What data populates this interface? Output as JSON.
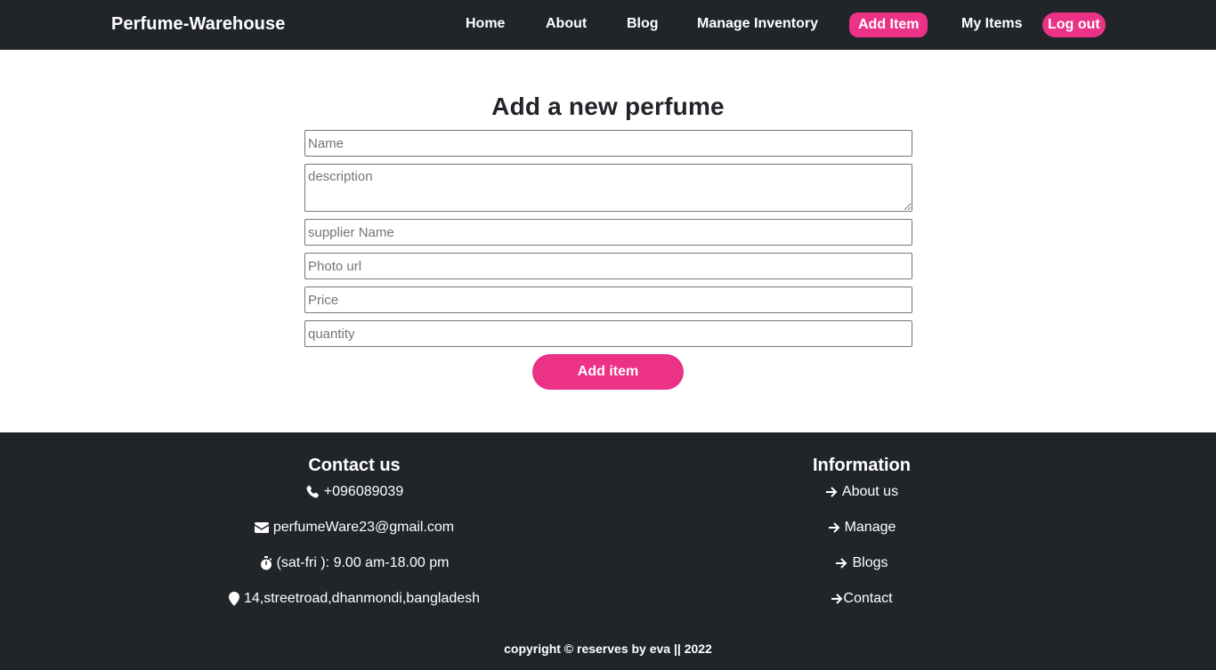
{
  "nav": {
    "brand": "Perfume-Warehouse",
    "home": "Home",
    "about": "About",
    "blog": "Blog",
    "manage_inventory": "Manage Inventory",
    "add_item": "Add Item",
    "my_items": "My Items",
    "logout": "Log out"
  },
  "form": {
    "title": "Add a new perfume",
    "name_placeholder": "Name",
    "description_placeholder": "description",
    "supplier_placeholder": "supplier Name",
    "photo_placeholder": "Photo url",
    "price_placeholder": "Price",
    "quantity_placeholder": "quantity",
    "submit_label": "Add item"
  },
  "footer": {
    "contact": {
      "title": "Contact us",
      "phone": "+096089039",
      "email": "perfumeWare23@gmail.com",
      "hours": "(sat-fri ): 9.00 am-18.00 pm",
      "address": "14,streetroad,dhanmondi,bangladesh"
    },
    "info": {
      "title": "Information",
      "about_us": "About us",
      "manage": "Manage",
      "blogs": "Blogs",
      "contact": "Contact"
    },
    "copyright": "copyright © reserves by eva || 2022"
  },
  "colors": {
    "dark": "#212529",
    "accent": "#ec3287"
  },
  "icons": [
    "phone-icon",
    "envelope-icon",
    "stopwatch-icon",
    "map-marker-icon",
    "arrow-right-icon"
  ]
}
